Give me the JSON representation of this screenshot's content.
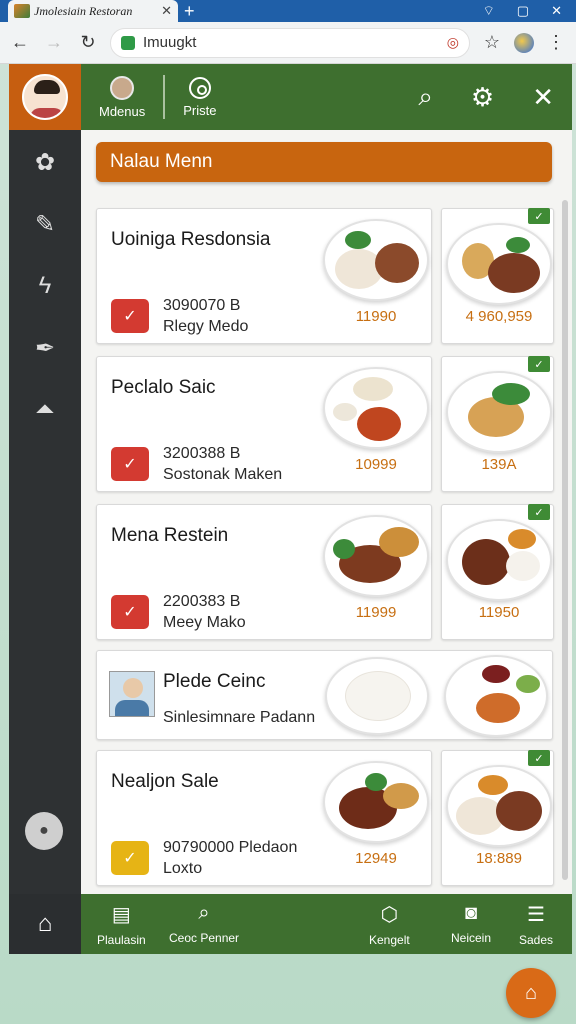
{
  "browser": {
    "tab_title": "Jmolesiain Restoran",
    "tab_close": "✕",
    "new_tab": "+",
    "url": "Imuugkt",
    "controls": [
      "⌔",
      "▢",
      "✕"
    ]
  },
  "header": {
    "items": [
      {
        "label": "Mdenus",
        "icon": "user-icon"
      },
      {
        "label": "Priste",
        "icon": "location-icon"
      }
    ],
    "actions": [
      "search-icon",
      "settings-icon",
      "close-icon"
    ]
  },
  "sidebar": {
    "icons": [
      "flower-icon",
      "edit-icon",
      "bolt-icon",
      "pen-icon",
      "chart-icon"
    ]
  },
  "banner": {
    "title": "Nalau Menn"
  },
  "cards": [
    {
      "title": "Uoiniga Resdonsia",
      "code": "3090070 B",
      "subtitle": "Rlegy Medo",
      "badge": "red",
      "price1": "11990",
      "price2": "4 960,959"
    },
    {
      "title": "Peclalo Saic",
      "code": "3200388 B",
      "subtitle": "Sostonak Maken",
      "badge": "red",
      "price1": "10999",
      "price2": "139A"
    },
    {
      "title": "Mena Restein",
      "code": "2200383 B",
      "subtitle": "Meey Mako",
      "badge": "red",
      "price1": "11999",
      "price2": "11950"
    },
    {
      "title": "Plede Ceinc",
      "subtitle": "Sinlesimnare Padann"
    },
    {
      "title": "Nealjon Sale",
      "code": "90790000 Pledaon",
      "subtitle": "Loxto",
      "badge": "yellow",
      "price1": "12949",
      "price2": "18:889"
    }
  ],
  "bottom_nav": [
    {
      "label": "Plaulasin",
      "icon": "document-icon"
    },
    {
      "label": "Ceoc Penner",
      "icon": "search-icon"
    },
    {
      "label": "Kengelt",
      "icon": "box-icon"
    },
    {
      "label": "Neicein",
      "icon": "camera-icon"
    },
    {
      "label": "Sades",
      "icon": "menu-icon"
    }
  ],
  "colors": {
    "header_green": "#3e6f2f",
    "accent_orange": "#c8650f",
    "price_orange": "#c76f12",
    "badge_red": "#d33a31"
  }
}
